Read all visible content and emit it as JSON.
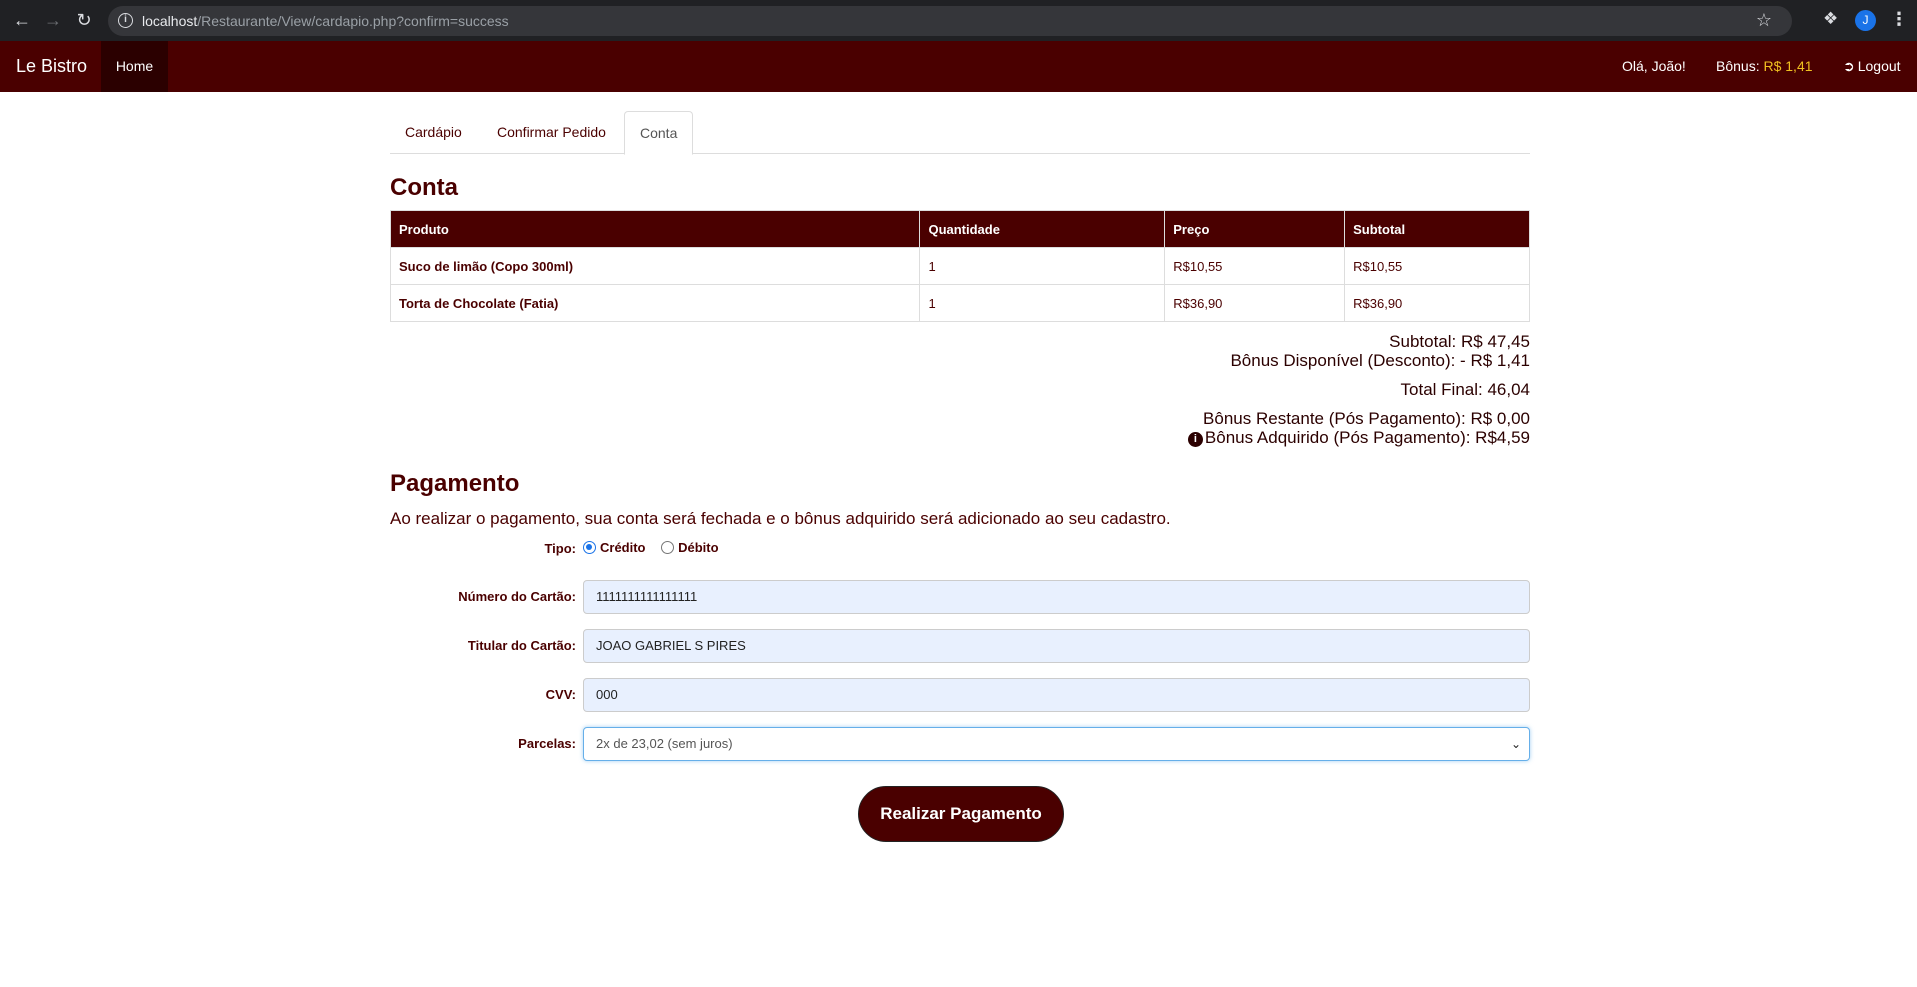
{
  "browser": {
    "url_host": "localhost",
    "url_path": "/Restaurante/View/cardapio.php?confirm=success",
    "profile_initial": "J"
  },
  "navbar": {
    "brand": "Le Bistro",
    "home": "Home",
    "greeting": "Olá, João!",
    "bonus_label": "Bônus: ",
    "bonus_value": "R$ 1,41",
    "logout": "Logout"
  },
  "tabs": [
    {
      "label": "Cardápio",
      "active": false
    },
    {
      "label": "Confirmar Pedido",
      "active": false
    },
    {
      "label": "Conta",
      "active": true
    }
  ],
  "conta": {
    "title": "Conta",
    "columns": [
      "Produto",
      "Quantidade",
      "Preço",
      "Subtotal"
    ],
    "rows": [
      {
        "produto": "Suco de limão (Copo 300ml)",
        "quantidade": "1",
        "preco": "R$10,55",
        "subtotal": "R$10,55"
      },
      {
        "produto": "Torta de Chocolate (Fatia)",
        "quantidade": "1",
        "preco": "R$36,90",
        "subtotal": "R$36,90"
      }
    ],
    "subtotal": "Subtotal: R$ 47,45",
    "bonus_disponivel": "Bônus Disponível (Desconto): - R$ 1,41",
    "total_final": "Total Final: 46,04",
    "bonus_restante": "Bônus Restante (Pós Pagamento): R$ 0,00",
    "bonus_adquirido": "Bônus Adquirido (Pós Pagamento): R$4,59"
  },
  "pagamento": {
    "title": "Pagamento",
    "description": "Ao realizar o pagamento, sua conta será fechada e o bônus adquirido será adicionado ao seu cadastro.",
    "tipo_label": "Tipo:",
    "tipo_options": [
      "Crédito",
      "Débito"
    ],
    "tipo_selected": "Crédito",
    "numero_label": "Número do Cartão:",
    "numero_value": "1111111111111111",
    "titular_label": "Titular do Cartão:",
    "titular_value": "JOAO GABRIEL S PIRES",
    "cvv_label": "CVV:",
    "cvv_value": "000",
    "parcelas_label": "Parcelas:",
    "parcelas_value": "2x de 23,02 (sem juros)",
    "submit": "Realizar Pagamento"
  }
}
